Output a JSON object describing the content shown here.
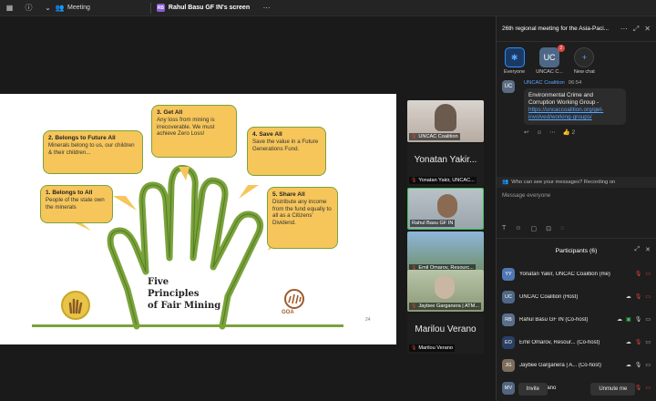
{
  "topbar": {
    "meeting_label": "Meeting",
    "share_label": "Rahul Basu GF IN's screen",
    "share_badge": "RB"
  },
  "slide": {
    "notes": [
      {
        "title": "1. Belongs to All",
        "text": "People of the state own the minerals"
      },
      {
        "title": "2. Belongs to Future All",
        "text": "Minerals belong to us, our children & their children..."
      },
      {
        "title": "3. Get All",
        "text": "Any loss from mining is irrecoverable. We must achieve Zero Loss!"
      },
      {
        "title": "4. Save All",
        "text": "Save the value in a Future Generations Fund."
      },
      {
        "title": "5. Share All",
        "text": "Distribute any income from the fund equally to all as a Citizens' Dividend."
      }
    ],
    "title_lines": [
      "Five",
      "Principles",
      "of Fair Mining"
    ],
    "page_number": "24",
    "logo_text": "GOA"
  },
  "tiles": [
    {
      "name": "UNCAC Coalition",
      "type": "video",
      "color": "#6b5a4e"
    },
    {
      "name": "Yonatan Yakir, UNCAC...",
      "big": "Yonatan Yakir...",
      "type": "name"
    },
    {
      "name": "Rahul Basu GF IN",
      "type": "video",
      "active": true,
      "color": "#8a6a52"
    },
    {
      "name": "Emil Omarov, Resourc...",
      "type": "video",
      "color": "#6c8fb0"
    },
    {
      "name": "Jaybee Garganera | ATM...",
      "type": "video",
      "color": "#7d8c6e"
    },
    {
      "name": "Marilou Verano",
      "big": "Marilou Verano",
      "type": "name"
    }
  ],
  "chat": {
    "title": "26th regional meeting for the Asia-Paci...",
    "chips": [
      {
        "label": "Everyone",
        "glyph": "✱",
        "selected": true
      },
      {
        "label": "UNCAC C...",
        "glyph": "UC",
        "badge": "2"
      },
      {
        "label": "New chat",
        "glyph": "+"
      }
    ],
    "message": {
      "avatar": "UC",
      "sender": "UNCAC Coalition",
      "time": "06:54",
      "text": "Environmental Crime and Corruption Working Group -",
      "link": "https://uncaccoalition.org/get-involved/working-groups/",
      "reaction_count": "2"
    },
    "visibility_text": "Who can see your messages? Recording on",
    "compose_placeholder": "Message everyone"
  },
  "participants": {
    "title": "Participants (6)",
    "list": [
      {
        "initials": "YY",
        "name": "Yonatan Yakir, UNCAC Coalition (me)",
        "color": "#4f78b4"
      },
      {
        "initials": "UC",
        "name": "UNCAC Coalition (Host)",
        "color": "#4e6786"
      },
      {
        "initials": "RB",
        "name": "Rahul Basu GF IN (Co-host)",
        "color": "#5a6f8c"
      },
      {
        "initials": "EO",
        "name": "Emil Omarov, Resour... (Co-host)",
        "color": "#2b3f63"
      },
      {
        "initials": "JG",
        "name": "Jaybee Garganera | A... (Co-host)",
        "color": "#7d6d5c"
      },
      {
        "initials": "MV",
        "name": "Marilou Verano",
        "color": "#52667f"
      }
    ],
    "invite_label": "Invite",
    "unmute_label": "Unmute me"
  }
}
